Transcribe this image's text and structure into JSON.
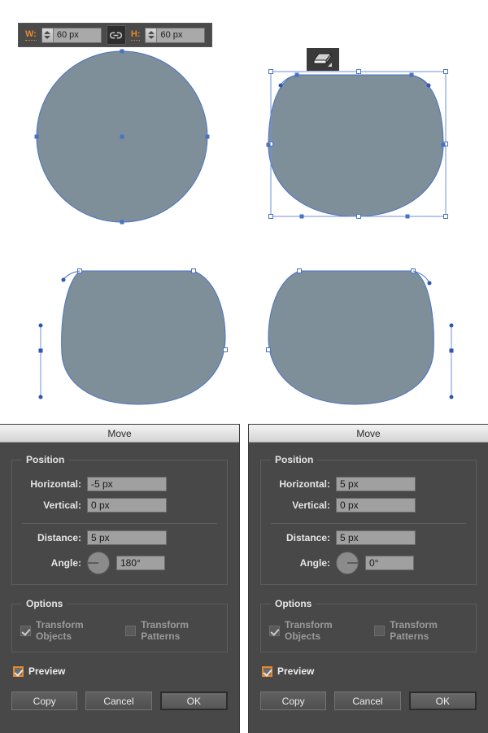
{
  "toolbar": {
    "width_label": "W:",
    "width_value": "60 px",
    "link_icon": "chain-link-icon",
    "height_label": "H:",
    "height_value": "60 px"
  },
  "tool_badge": {
    "icon": "eraser-icon",
    "name": "Eraser Tool"
  },
  "artwork": {
    "fill_color": "#7f8f99",
    "stroke_color": "#4a72c4",
    "shapes": [
      {
        "name": "circle-shape",
        "label": "60 px circle with four anchor points and center point"
      },
      {
        "name": "flattened-top-shape-selected",
        "label": "Shape with flattened top and selection bounding box"
      },
      {
        "name": "shape-left-handle",
        "label": "Shape with left-side direction handle extended"
      },
      {
        "name": "shape-right-handle",
        "label": "Shape with right-side direction handle extended"
      }
    ]
  },
  "dialogs": [
    {
      "id": "move-left",
      "title": "Move",
      "position_group": "Position",
      "horizontal_label": "Horizontal:",
      "horizontal_value": "-5 px",
      "vertical_label": "Vertical:",
      "vertical_value": "0 px",
      "distance_label": "Distance:",
      "distance_value": "5 px",
      "angle_label": "Angle:",
      "angle_value": "180°",
      "angle_needle": "left",
      "options_group": "Options",
      "transform_objects_label": "Transform Objects",
      "transform_objects_checked": true,
      "transform_patterns_label": "Transform Patterns",
      "transform_patterns_checked": false,
      "preview_label": "Preview",
      "preview_checked": true,
      "copy_label": "Copy",
      "cancel_label": "Cancel",
      "ok_label": "OK"
    },
    {
      "id": "move-right",
      "title": "Move",
      "position_group": "Position",
      "horizontal_label": "Horizontal:",
      "horizontal_value": "5 px",
      "vertical_label": "Vertical:",
      "vertical_value": "0 px",
      "distance_label": "Distance:",
      "distance_value": "5 px",
      "angle_label": "Angle:",
      "angle_value": "0°",
      "angle_needle": "right",
      "options_group": "Options",
      "transform_objects_label": "Transform Objects",
      "transform_objects_checked": true,
      "transform_patterns_label": "Transform Patterns",
      "transform_patterns_checked": false,
      "preview_label": "Preview",
      "preview_checked": true,
      "copy_label": "Copy",
      "cancel_label": "Cancel",
      "ok_label": "OK"
    }
  ],
  "colors": {
    "accent_orange": "#e8892b",
    "dialog_bg": "#484848",
    "field_bg": "#a0a0a0",
    "shape_fill": "#7f8f99",
    "selection_blue": "#4a72c4"
  }
}
